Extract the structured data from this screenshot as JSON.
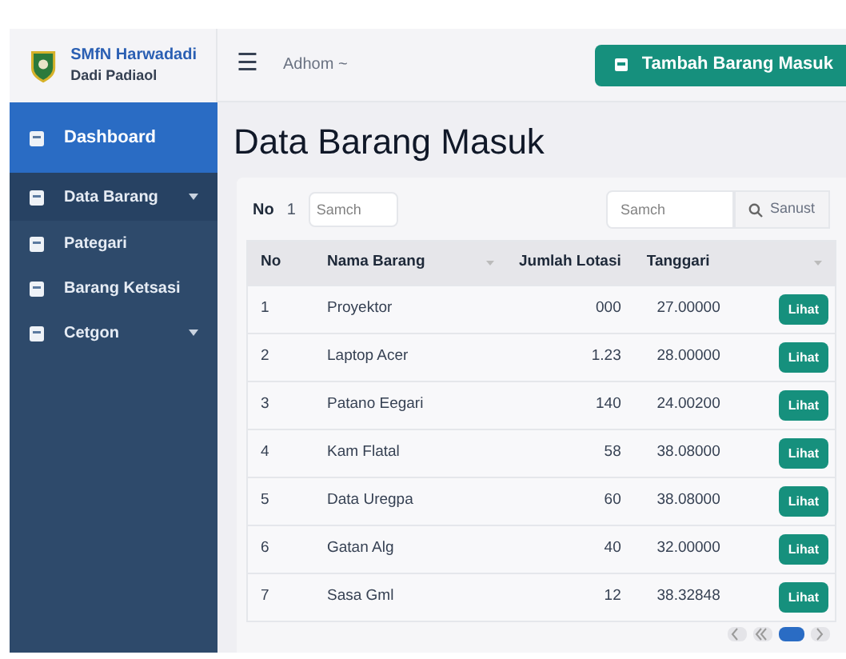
{
  "brand": {
    "title": "SMfN Harwadadi",
    "subtitle": "Dadi Padiaol"
  },
  "header": {
    "menu_glyph": "☰",
    "user": "Adhom ~",
    "add_button": "Tambah Barang Masuk"
  },
  "sidebar": {
    "items": [
      {
        "label": "Dashboard",
        "selected": true,
        "has_submenu": false
      },
      {
        "label": "Data Barang",
        "selected": false,
        "has_submenu": true
      },
      {
        "label": "Pategari",
        "selected": false,
        "has_submenu": false
      },
      {
        "label": "Barang Ketsasi",
        "selected": false,
        "has_submenu": false
      },
      {
        "label": "Cetgon",
        "selected": false,
        "has_submenu": true
      }
    ]
  },
  "page_title": "Data Barang Masuk",
  "toolbar": {
    "length_label": "No",
    "length_value": "1",
    "length_placeholder": "Samch",
    "search_placeholder": "Samch",
    "search_button": "Sanust"
  },
  "table": {
    "columns": [
      {
        "label": "No",
        "sortable": false
      },
      {
        "label": "Nama Barang",
        "sortable": true
      },
      {
        "label": "Jumlah Lotasi",
        "sortable": false
      },
      {
        "label": "Tanggari",
        "sortable": false
      },
      {
        "sortable": true
      }
    ],
    "rows": [
      {
        "no": "1",
        "name": "Proyektor",
        "qty": "000",
        "date": "27.00000",
        "action": "Lihat"
      },
      {
        "no": "2",
        "name": "Laptop Acer",
        "qty": "1.23",
        "date": "28.00000",
        "action": "Lihat"
      },
      {
        "no": "3",
        "name": "Patano Eegari",
        "qty": "140",
        "date": "24.00200",
        "action": "Lihat"
      },
      {
        "no": "4",
        "name": "Kam Flatal",
        "qty": "58",
        "date": "38.08000",
        "action": "Lihat"
      },
      {
        "no": "5",
        "name": "Data Uregpa",
        "qty": "60",
        "date": "38.08000",
        "action": "Lihat"
      },
      {
        "no": "6",
        "name": "Gatan Alg",
        "qty": "40",
        "date": "32.00000",
        "action": "Lihat"
      },
      {
        "no": "7",
        "name": "Sasa Gml",
        "qty": "12",
        "date": "38.32848",
        "action": "Lihat"
      }
    ]
  },
  "pagination": [
    {
      "kind": "prev",
      "selected": false
    },
    {
      "kind": "first",
      "selected": false
    },
    {
      "kind": "page",
      "selected": true
    },
    {
      "kind": "next",
      "selected": false
    }
  ]
}
